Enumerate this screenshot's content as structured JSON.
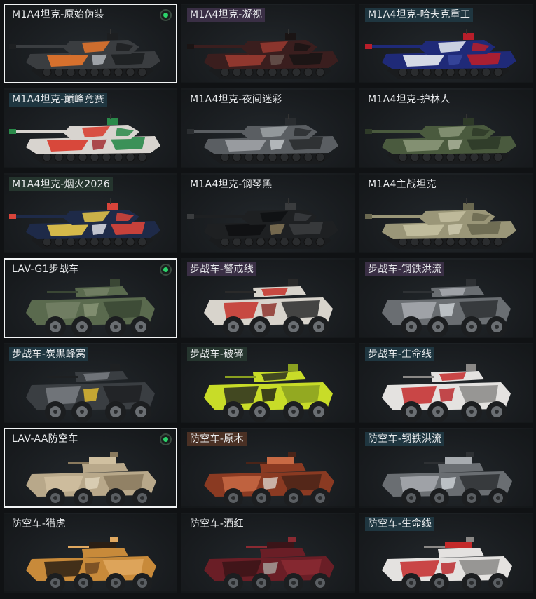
{
  "skins": [
    {
      "label": "M1A4坦克-原始伪装",
      "tag": "none",
      "selected": true,
      "equipped": true,
      "vehicle": "tank",
      "colors": [
        "#3a3d40",
        "#e8762b",
        "#1d1f21",
        "#b8bcc0"
      ]
    },
    {
      "label": "M1A4坦克-凝视",
      "tag": "purple",
      "selected": false,
      "equipped": false,
      "vehicle": "tank",
      "colors": [
        "#3a1e1e",
        "#9a3a30",
        "#1a1414",
        "#6a5650"
      ]
    },
    {
      "label": "M1A4坦克-哈夫克重工",
      "tag": "teal",
      "selected": false,
      "equipped": false,
      "vehicle": "tank",
      "colors": [
        "#1f2a78",
        "#e8ecf2",
        "#b81e2a",
        "#3a4aa0"
      ]
    },
    {
      "label": "M1A4坦克-巅峰竞赛",
      "tag": "teal",
      "selected": false,
      "equipped": false,
      "vehicle": "tank",
      "colors": [
        "#d8d4cf",
        "#d8382a",
        "#2a8a4a",
        "#a0262a"
      ]
    },
    {
      "label": "M1A4坦克-夜间迷彩",
      "tag": "none",
      "selected": false,
      "equipped": false,
      "vehicle": "tank",
      "colors": [
        "#5a5e62",
        "#9ea2a6",
        "#2a2d30",
        "#c8ccd0"
      ]
    },
    {
      "label": "M1A4坦克-护林人",
      "tag": "none",
      "selected": false,
      "equipped": false,
      "vehicle": "tank",
      "colors": [
        "#4a5a3e",
        "#8a9678",
        "#2e3a28",
        "#b0b8a0"
      ]
    },
    {
      "label": "M1A4坦克-烟火2026",
      "tag": "green",
      "selected": false,
      "equipped": false,
      "vehicle": "tank",
      "colors": [
        "#1e2a48",
        "#e8c84a",
        "#d8443a",
        "#e8eaf0"
      ]
    },
    {
      "label": "M1A4坦克-钢琴黑",
      "tag": "none",
      "selected": false,
      "equipped": false,
      "vehicle": "tank",
      "colors": [
        "#1e2022",
        "#0e1012",
        "#3a3c3e",
        "#8a7a5a"
      ]
    },
    {
      "label": "M1A4主战坦克",
      "tag": "none",
      "selected": false,
      "equipped": false,
      "vehicle": "tank",
      "colors": [
        "#9a9678",
        "#c4c0a0",
        "#6a6850",
        "#d0ccb0"
      ]
    },
    {
      "label": "LAV-G1步战车",
      "tag": "none",
      "selected": true,
      "equipped": true,
      "vehicle": "ifv",
      "colors": [
        "#5a6a4e",
        "#748066",
        "#3a4634",
        "#8a9678"
      ]
    },
    {
      "label": "步战车-警戒线",
      "tag": "purple",
      "selected": false,
      "equipped": false,
      "vehicle": "ifv",
      "colors": [
        "#d8d4cc",
        "#c43028",
        "#2a2a2a",
        "#8a2a24"
      ]
    },
    {
      "label": "步战车-钢铁洪流",
      "tag": "purple",
      "selected": false,
      "equipped": false,
      "vehicle": "ifv",
      "colors": [
        "#6a6e72",
        "#a8acb0",
        "#2e3134",
        "#d0d4d8"
      ]
    },
    {
      "label": "步战车-炭黑蜂窝",
      "tag": "teal",
      "selected": false,
      "equipped": false,
      "vehicle": "ifv",
      "colors": [
        "#3a3e42",
        "#7a7e82",
        "#1e2022",
        "#e8c030"
      ]
    },
    {
      "label": "步战车-破碎",
      "tag": "green",
      "selected": false,
      "equipped": false,
      "vehicle": "ifv",
      "colors": [
        "#c8dc28",
        "#2a2e20",
        "#8aa020",
        "#1a1c14"
      ]
    },
    {
      "label": "步战车-生命线",
      "tag": "teal",
      "selected": false,
      "equipped": false,
      "vehicle": "ifv",
      "colors": [
        "#e4e2e0",
        "#c42a2a",
        "#8a8886",
        "#b82024"
      ]
    },
    {
      "label": "LAV-AA防空车",
      "tag": "none",
      "selected": true,
      "equipped": true,
      "vehicle": "aa",
      "colors": [
        "#b8a88a",
        "#d0c0a0",
        "#8a7a5e",
        "#e0d4bc"
      ]
    },
    {
      "label": "防空车-原木",
      "tag": "bronze",
      "selected": false,
      "equipped": false,
      "vehicle": "aa",
      "colors": [
        "#8a3a22",
        "#c86a44",
        "#4a2418",
        "#d8d0c8"
      ]
    },
    {
      "label": "防空车-钢铁洪流",
      "tag": "teal",
      "selected": false,
      "equipped": false,
      "vehicle": "aa",
      "colors": [
        "#6a6e72",
        "#a8acb0",
        "#2e3134",
        "#d0d4d8"
      ]
    },
    {
      "label": "防空车-猎虎",
      "tag": "none",
      "selected": false,
      "equipped": false,
      "vehicle": "aa",
      "colors": [
        "#c88a3a",
        "#2a1e14",
        "#e0a860",
        "#6a4420"
      ]
    },
    {
      "label": "防空车-酒红",
      "tag": "none",
      "selected": false,
      "equipped": false,
      "vehicle": "aa",
      "colors": [
        "#6a1e26",
        "#3a1418",
        "#8a2a32",
        "#a8a4a0"
      ]
    },
    {
      "label": "防空车-生命线",
      "tag": "teal",
      "selected": false,
      "equipped": false,
      "vehicle": "aa",
      "colors": [
        "#e4e2e0",
        "#c42a2a",
        "#8a8886",
        "#b82024"
      ]
    }
  ]
}
